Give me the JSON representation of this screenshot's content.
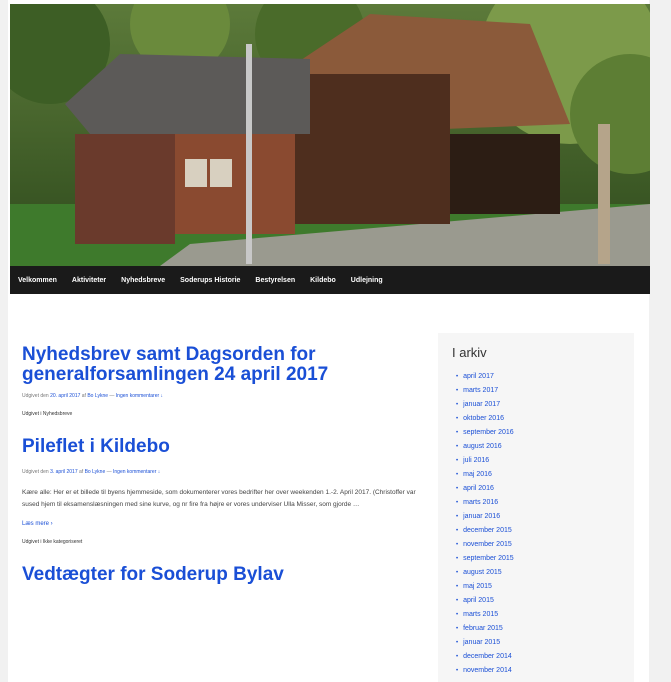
{
  "nav": {
    "items": [
      "Velkommen",
      "Aktiviteter",
      "Nyhedsbreve",
      "Soderups Historie",
      "Bestyrelsen",
      "Kildebo",
      "Udlejning"
    ]
  },
  "posts": [
    {
      "title": "Nyhedsbrev samt Dagsorden for generalforsamlingen 24 april 2017",
      "meta_prefix": "Udgivet den",
      "date": "20. april 2017",
      "author_prefix": "af",
      "author": "Bo Lykne",
      "comments": "Ingen kommentarer ↓",
      "category": "Udgivet i Nyhedsbreve"
    },
    {
      "title": "Pileflet i Kildebo",
      "meta_prefix": "Udgivet den",
      "date": "3. april 2017",
      "author_prefix": "af",
      "author": "Bo Lykne",
      "comments": "Ingen kommentarer ↓",
      "excerpt": "Kære alle: Her er et billede til byens hjemmeside, som dokumenterer vores bedrifter her over weekenden 1.-2. April 2017. (Christoffer var sused hjem til eksamenslæsningen med sine kurve, og nr fire fra højre er vores underviser Ulla Misser, som gjorde …",
      "read_more": "Læs mere ›",
      "category": "Udgivet i Ikke kategoriseret"
    },
    {
      "title": "Vedtægter for Soderup Bylav"
    }
  ],
  "sidebar": {
    "title": "I arkiv",
    "archive": [
      "april 2017",
      "marts 2017",
      "januar 2017",
      "oktober 2016",
      "september 2016",
      "august 2016",
      "juli 2016",
      "maj 2016",
      "april 2016",
      "marts 2016",
      "januar 2016",
      "december 2015",
      "november 2015",
      "september 2015",
      "august 2015",
      "maj 2015",
      "april 2015",
      "marts 2015",
      "februar 2015",
      "januar 2015",
      "december 2014",
      "november 2014"
    ]
  }
}
